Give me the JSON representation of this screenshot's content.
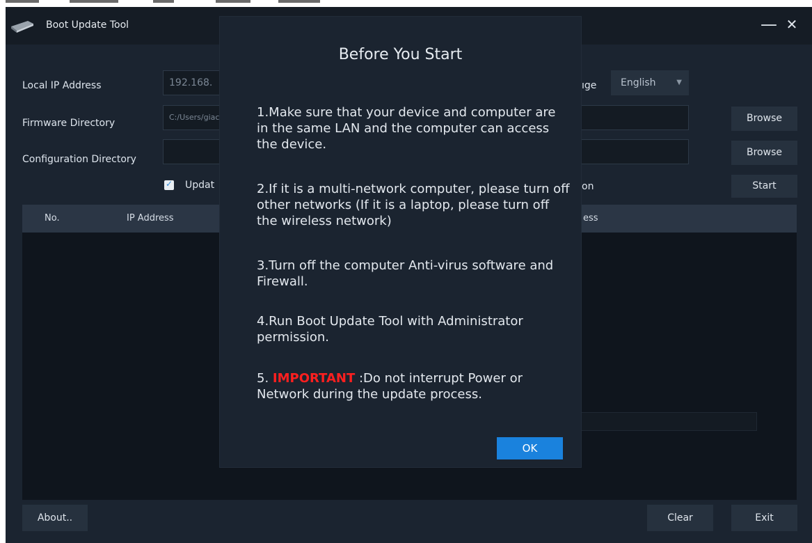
{
  "window": {
    "title": "Boot Update Tool",
    "minimize_glyph": "—",
    "close_glyph": "✕"
  },
  "form": {
    "local_ip_label": "Local IP Address",
    "local_ip_value": "192.168.",
    "language_label_partial": "ıge",
    "language_value": "English",
    "firmware_label": "Firmware Directory",
    "firmware_value": "C:/Users/giac",
    "config_label": "Configuration Directory",
    "config_value": "",
    "browse_label": "Browse",
    "browse2_label": "Browse",
    "update_checkbox_label": "Updat",
    "right_option_partial": "on",
    "start_label": "Start"
  },
  "table": {
    "columns": [
      "No.",
      "IP Address"
    ],
    "right_column_partial": "ess"
  },
  "footer": {
    "about_label": "About..",
    "clear_label": "Clear",
    "exit_label": "Exit"
  },
  "dialog": {
    "title": "Before You Start",
    "items": [
      "1.Make sure that your device and computer are in the same LAN and the computer can access the device.",
      "2.If it is a multi-network computer, please turn off other networks (If it is a laptop, please turn off the wireless network)",
      "3.Turn off the computer Anti-virus software and Firewall.",
      "4.Run Boot Update Tool with Administrator permission."
    ],
    "item5_prefix": "5. ",
    "item5_important": "IMPORTANT",
    "item5_rest": " :Do not interrupt Power or Network during the update process.",
    "ok_label": "OK"
  },
  "colors": {
    "accent": "#1a82dd",
    "warning": "#ff1f1f",
    "background": "#1b2430"
  },
  "icons": [
    "app-logo-icon",
    "minimize-icon",
    "close-icon",
    "checkbox-check-icon",
    "dropdown-caret-icon"
  ]
}
